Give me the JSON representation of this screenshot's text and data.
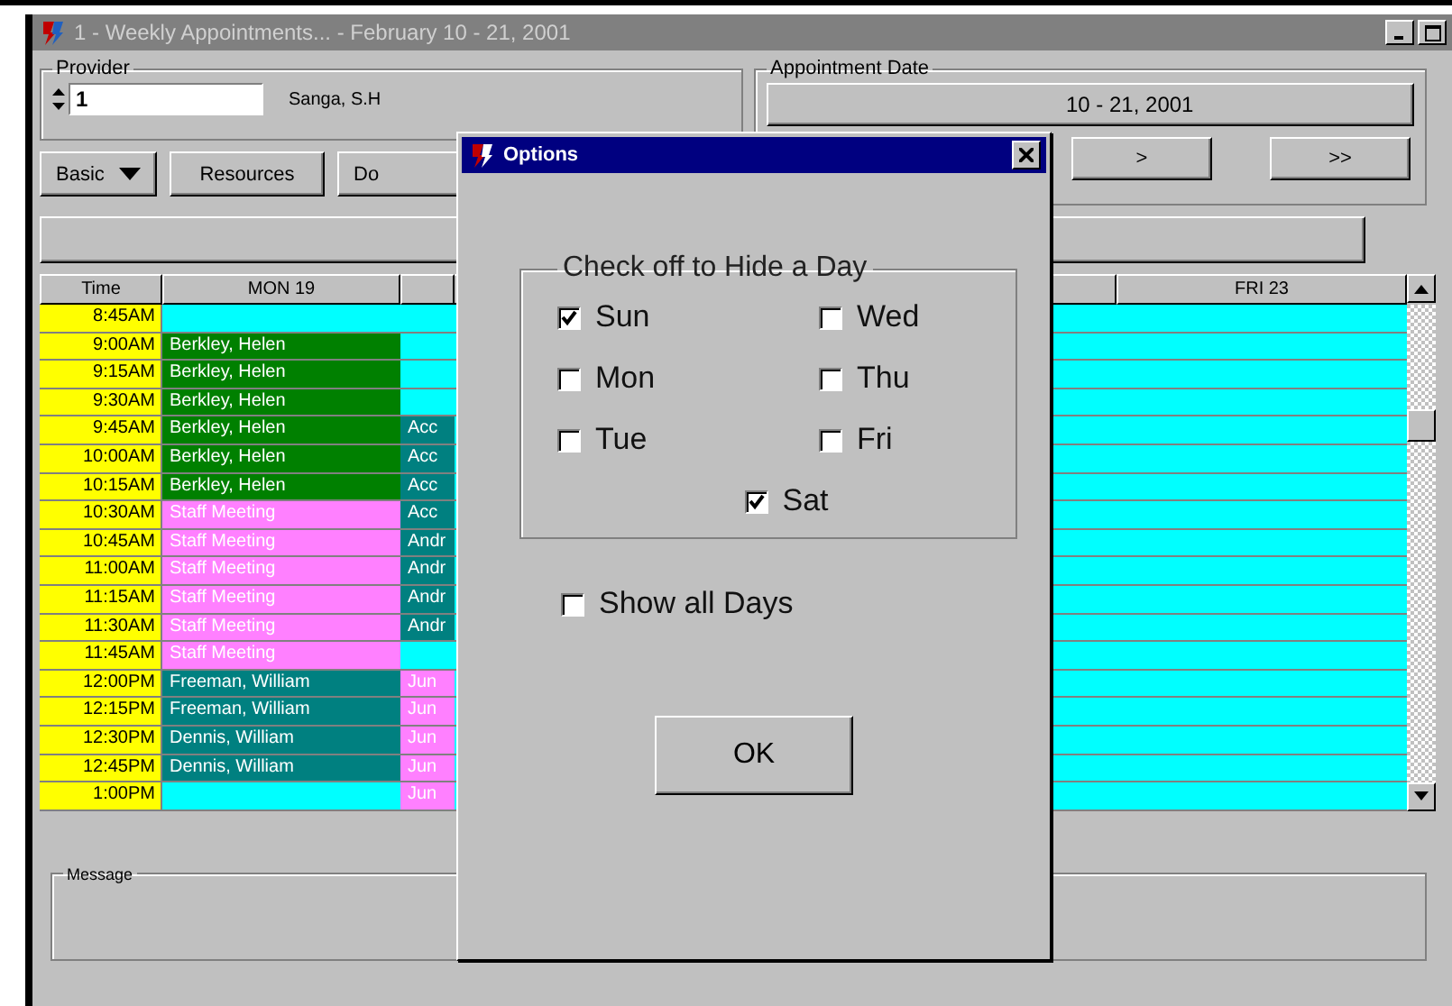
{
  "window": {
    "title": "1 - Weekly Appointments... - February 10 - 21, 2001"
  },
  "provider": {
    "label": "Provider",
    "number": "1",
    "name": "Sanga, S.H"
  },
  "buttons": [
    {
      "label": "Basic",
      "kind": "dropdown"
    },
    {
      "label": "Resources",
      "kind": "plain"
    },
    {
      "label": "Do",
      "kind": "plain"
    }
  ],
  "appointment_date": {
    "label": "Appointment Date",
    "date": "10 - 21, 2001",
    "nav": [
      ">",
      ">>"
    ]
  },
  "table": {
    "columns": [
      {
        "label": "Time"
      },
      {
        "label": "MON 19"
      },
      {},
      {},
      {},
      {
        "label": "FRI 23"
      }
    ],
    "rows": [
      {
        "time": "8:45AM",
        "mon": {
          "color": "#00ffff"
        },
        "tue": {
          "color": "#00ffff"
        }
      },
      {
        "time": "9:00AM",
        "mon": {
          "text": "Berkley, Helen",
          "color": "#008000"
        },
        "tue": {
          "color": "#00ffff"
        }
      },
      {
        "time": "9:15AM",
        "mon": {
          "text": "Berkley, Helen",
          "color": "#008000"
        },
        "tue": {
          "color": "#00ffff"
        }
      },
      {
        "time": "9:30AM",
        "mon": {
          "text": "Berkley, Helen",
          "color": "#008000"
        },
        "tue": {
          "color": "#00ffff"
        }
      },
      {
        "time": "9:45AM",
        "mon": {
          "text": "Berkley, Helen",
          "color": "#008000"
        },
        "tue": {
          "text": "Acc",
          "color": "#008080"
        }
      },
      {
        "time": "10:00AM",
        "mon": {
          "text": "Berkley, Helen",
          "color": "#008000"
        },
        "tue": {
          "text": "Acc",
          "color": "#008080"
        }
      },
      {
        "time": "10:15AM",
        "mon": {
          "text": "Berkley, Helen",
          "color": "#008000"
        },
        "tue": {
          "text": "Acc",
          "color": "#008080"
        }
      },
      {
        "time": "10:30AM",
        "mon": {
          "text": "Staff Meeting",
          "color": "#ff80ff"
        },
        "tue": {
          "text": "Acc",
          "color": "#008080"
        }
      },
      {
        "time": "10:45AM",
        "mon": {
          "text": "Staff Meeting",
          "color": "#ff80ff"
        },
        "tue": {
          "text": "Andr",
          "color": "#008080"
        }
      },
      {
        "time": "11:00AM",
        "mon": {
          "text": "Staff Meeting",
          "color": "#ff80ff"
        },
        "tue": {
          "text": "Andr",
          "color": "#008080"
        }
      },
      {
        "time": "11:15AM",
        "mon": {
          "text": "Staff Meeting",
          "color": "#ff80ff"
        },
        "tue": {
          "text": "Andr",
          "color": "#008080"
        }
      },
      {
        "time": "11:30AM",
        "mon": {
          "text": "Staff Meeting",
          "color": "#ff80ff"
        },
        "tue": {
          "text": "Andr",
          "color": "#008080"
        }
      },
      {
        "time": "11:45AM",
        "mon": {
          "text": "Staff Meeting",
          "color": "#ff80ff"
        },
        "tue": {
          "color": "#00ffff"
        }
      },
      {
        "time": "12:00PM",
        "mon": {
          "text": "Freeman, William",
          "color": "#008080"
        },
        "tue": {
          "text": "Jun",
          "color": "#ff80ff"
        }
      },
      {
        "time": "12:15PM",
        "mon": {
          "text": "Freeman, William",
          "color": "#008080"
        },
        "tue": {
          "text": "Jun",
          "color": "#ff80ff"
        }
      },
      {
        "time": "12:30PM",
        "mon": {
          "text": "Dennis, William",
          "color": "#008080"
        },
        "tue": {
          "text": "Jun",
          "color": "#ff80ff"
        }
      },
      {
        "time": "12:45PM",
        "mon": {
          "text": "Dennis, William",
          "color": "#008080"
        },
        "tue": {
          "text": "Jun",
          "color": "#ff80ff"
        }
      },
      {
        "time": "1:00PM",
        "mon": {
          "color": "#00ffff"
        },
        "tue": {
          "text": "Jun",
          "color": "#ff80ff"
        }
      }
    ]
  },
  "message": {
    "label": "Message"
  },
  "dialog": {
    "title": "Options",
    "group_label": "Check off to Hide a Day",
    "days": [
      {
        "label": "Sun",
        "checked": true
      },
      {
        "label": "Mon",
        "checked": false
      },
      {
        "label": "Tue",
        "checked": false
      },
      {
        "label": "Wed",
        "checked": false
      },
      {
        "label": "Thu",
        "checked": false
      },
      {
        "label": "Fri",
        "checked": false
      },
      {
        "label": "Sat",
        "checked": true
      }
    ],
    "show_all": {
      "label": "Show all Days",
      "checked": false
    },
    "ok": "OK"
  }
}
